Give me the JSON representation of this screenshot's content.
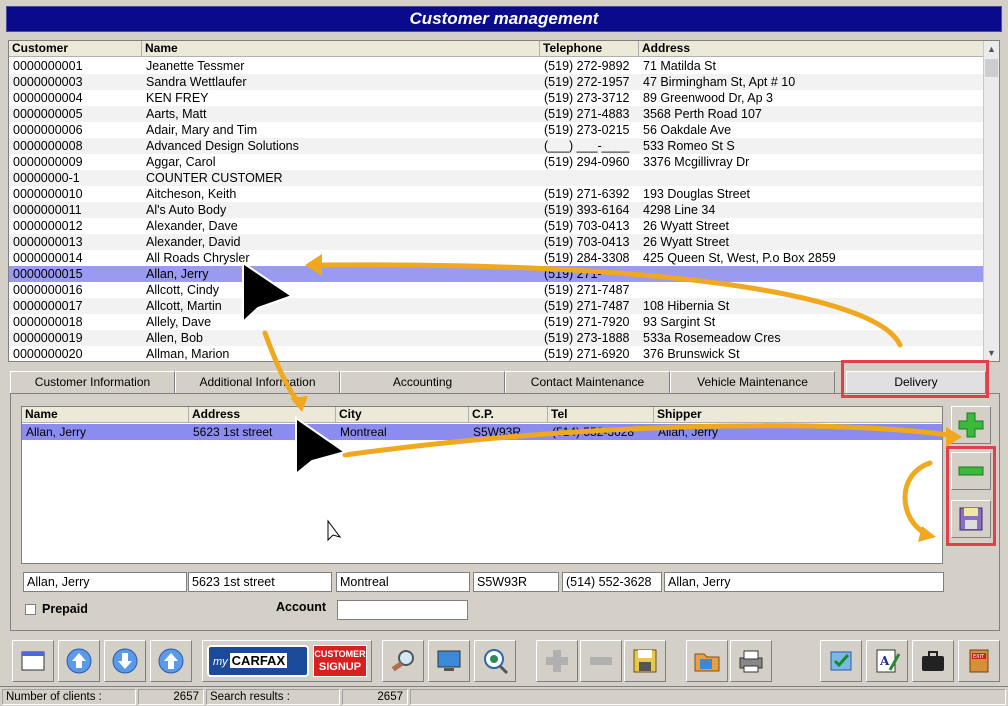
{
  "window": {
    "title": "Customer management"
  },
  "customers": {
    "columns": [
      "Customer",
      "Name",
      "Telephone",
      "Address"
    ],
    "rows": [
      [
        "0000000001",
        "Jeanette Tessmer",
        "(519) 272-9892",
        "71 Matilda St"
      ],
      [
        "0000000003",
        "Sandra Wettlaufer",
        "(519) 272-1957",
        "47 Birmingham St, Apt # 10"
      ],
      [
        "0000000004",
        " KEN FREY",
        "(519) 273-3712",
        "89 Greenwood Dr, Ap 3"
      ],
      [
        "0000000005",
        "Aarts, Matt",
        "(519) 271-4883",
        "3568 Perth Road 107"
      ],
      [
        "0000000006",
        "Adair, Mary and Tim",
        "(519) 273-0215",
        "56 Oakdale Ave"
      ],
      [
        "0000000008",
        "Advanced Design Solutions",
        "(___) ___-____",
        "533 Romeo St S"
      ],
      [
        "0000000009",
        "Aggar, Carol",
        "(519) 294-0960",
        "3376 Mcgillivray Dr"
      ],
      [
        "00000000-1",
        "COUNTER CUSTOMER",
        "",
        ""
      ],
      [
        "0000000010",
        "Aitcheson, Keith",
        "(519) 271-6392",
        "193 Douglas Street"
      ],
      [
        "0000000011",
        "Al's Auto Body",
        "(519) 393-6164",
        "4298 Line 34"
      ],
      [
        "0000000012",
        "Alexander, Dave",
        "(519) 703-0413",
        "26 Wyatt Street"
      ],
      [
        "0000000013",
        "Alexander, David",
        "(519) 703-0413",
        "26 Wyatt Street"
      ],
      [
        "0000000014",
        "All Roads Chrysler",
        "(519) 284-3308",
        "425 Queen St, West, P.o Box 2859"
      ],
      [
        "0000000015",
        "Allan, Jerry",
        "(519) 271-",
        ""
      ],
      [
        "0000000016",
        "Allcott, Cindy",
        "(519) 271-7487",
        ""
      ],
      [
        "0000000017",
        "Allcott, Martin",
        "(519) 271-7487",
        "108 Hibernia St"
      ],
      [
        "0000000018",
        "Allely, Dave",
        "(519) 271-7920",
        "93 Sargint St"
      ],
      [
        "0000000019",
        "Allen, Bob",
        "(519) 273-1888",
        "533a Rosemeadow Cres"
      ],
      [
        "0000000020",
        "Allman, Marion",
        "(519) 271-6920",
        "376 Brunswick St"
      ]
    ],
    "selected_index": 13
  },
  "tabs": [
    {
      "label": "Customer Information"
    },
    {
      "label": "Additional Information"
    },
    {
      "label": "Accounting"
    },
    {
      "label": "Contact Maintenance"
    },
    {
      "label": "Vehicle Maintenance"
    },
    {
      "label": "Delivery",
      "active": true
    }
  ],
  "delivery": {
    "columns": [
      "Name",
      "Address",
      "City",
      "C.P.",
      "Tel",
      "Shipper"
    ],
    "row": [
      "Allan, Jerry",
      "5623 1st street",
      "Montreal",
      "S5W93R",
      "(514) 552-3628",
      "Allan, Jerry"
    ],
    "fields": [
      "Allan, Jerry",
      "5623 1st street",
      "Montreal",
      "S5W93R",
      "(514) 552-3628",
      "Allan, Jerry"
    ],
    "prepaid_label": "Prepaid",
    "account_label": "Account",
    "account_value": ""
  },
  "carfax": {
    "brand_my": "my",
    "brand_name": "CARFAX",
    "signup_line1": "CUSTOMER",
    "signup_line2": "SIGNUP"
  },
  "status": {
    "clients_label": "Number of clients :",
    "clients_value": "2657",
    "search_label": "Search results :",
    "search_value": "2657"
  },
  "colors": {
    "title_bg": "#0a0a8c",
    "selection": "#9a9af0",
    "highlight_box": "#e0404a",
    "annotation_arrow": "#f0a81e"
  }
}
